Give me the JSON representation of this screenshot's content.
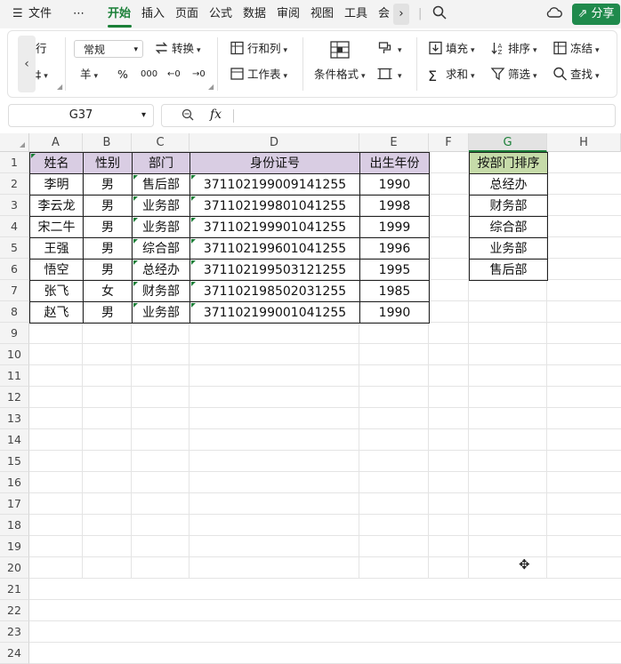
{
  "menu": {
    "items": [
      "文件",
      "⋯",
      "开始",
      "插入",
      "页面",
      "公式",
      "数据",
      "审阅",
      "视图",
      "工具",
      "会"
    ],
    "active": "开始",
    "share": "分享"
  },
  "ribbon": {
    "partial_top": "行",
    "partial_bottom": "‡",
    "number_format": "常规",
    "convert": "转换",
    "currency": "羊",
    "percent": "%",
    "thousands": "000",
    "dec_inc": "←0",
    "dec_dec": "→0",
    "row_col": "行和列",
    "worksheet": "工作表",
    "cond_format": "条件格式",
    "fill": "填充",
    "sum": "求和",
    "sort": "排序",
    "filter": "筛选",
    "freeze": "冻结",
    "find": "查找"
  },
  "formula_bar": {
    "cell_ref": "G37",
    "fx": "fx",
    "value": ""
  },
  "columns": [
    "A",
    "B",
    "C",
    "D",
    "E",
    "F",
    "G",
    "H"
  ],
  "rows": [
    "1",
    "2",
    "3",
    "4",
    "5",
    "6",
    "7",
    "8",
    "9",
    "10",
    "11",
    "12",
    "13",
    "14",
    "15",
    "16",
    "17",
    "18",
    "19",
    "20",
    "21",
    "22",
    "23",
    "24"
  ],
  "table": {
    "headers": [
      "姓名",
      "性别",
      "部门",
      "身份证号",
      "出生年份"
    ],
    "rows": [
      [
        "李明",
        "男",
        "售后部",
        "371102199009141255",
        "1990"
      ],
      [
        "李云龙",
        "男",
        "业务部",
        "371102199801041255",
        "1998"
      ],
      [
        "宋二牛",
        "男",
        "业务部",
        "371102199901041255",
        "1999"
      ],
      [
        "王强",
        "男",
        "综合部",
        "371102199601041255",
        "1996"
      ],
      [
        "悟空",
        "男",
        "总经办",
        "371102199503121255",
        "1995"
      ],
      [
        "张飞",
        "女",
        "财务部",
        "371102198502031255",
        "1985"
      ],
      [
        "赵飞",
        "男",
        "业务部",
        "371102199001041255",
        "1990"
      ]
    ]
  },
  "sort_table": {
    "header": "按部门排序",
    "items": [
      "总经办",
      "财务部",
      "综合部",
      "业务部",
      "售后部"
    ]
  },
  "colors": {
    "accent": "#1a7f37",
    "header_purple": "#d9cde3",
    "header_green": "#c6dba9"
  }
}
